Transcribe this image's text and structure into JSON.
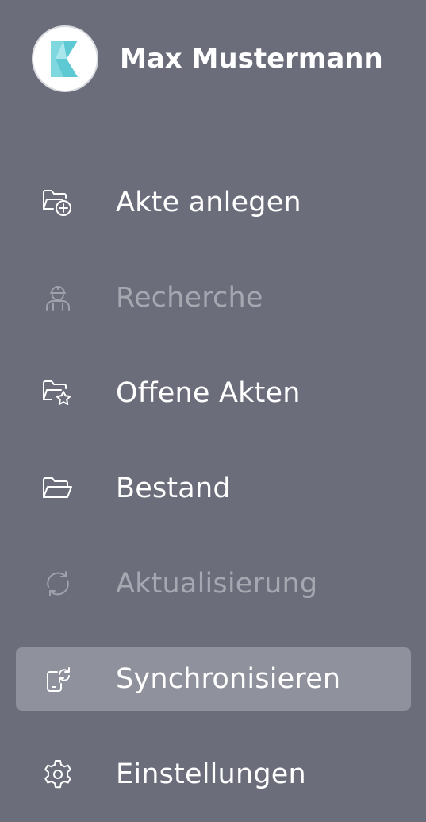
{
  "profile": {
    "name": "Max Mustermann",
    "avatar_icon": "k-logo-icon"
  },
  "menu": {
    "items": [
      {
        "label": "Akte anlegen",
        "icon": "folder-plus-icon",
        "state": "enabled"
      },
      {
        "label": "Recherche",
        "icon": "worker-icon",
        "state": "disabled"
      },
      {
        "label": "Offene Akten",
        "icon": "folder-star-icon",
        "state": "enabled"
      },
      {
        "label": "Bestand",
        "icon": "folder-open-icon",
        "state": "enabled"
      },
      {
        "label": "Aktualisierung",
        "icon": "refresh-icon",
        "state": "disabled"
      },
      {
        "label": "Synchronisieren",
        "icon": "phone-sync-icon",
        "state": "active"
      },
      {
        "label": "Einstellungen",
        "icon": "gear-icon",
        "state": "enabled"
      }
    ]
  },
  "colors": {
    "background": "#6b6d7b",
    "active_background": "#8f919d",
    "text": "#ffffff",
    "disabled_text": "#a6a8b1",
    "logo_accent": "#5fd0d8"
  }
}
